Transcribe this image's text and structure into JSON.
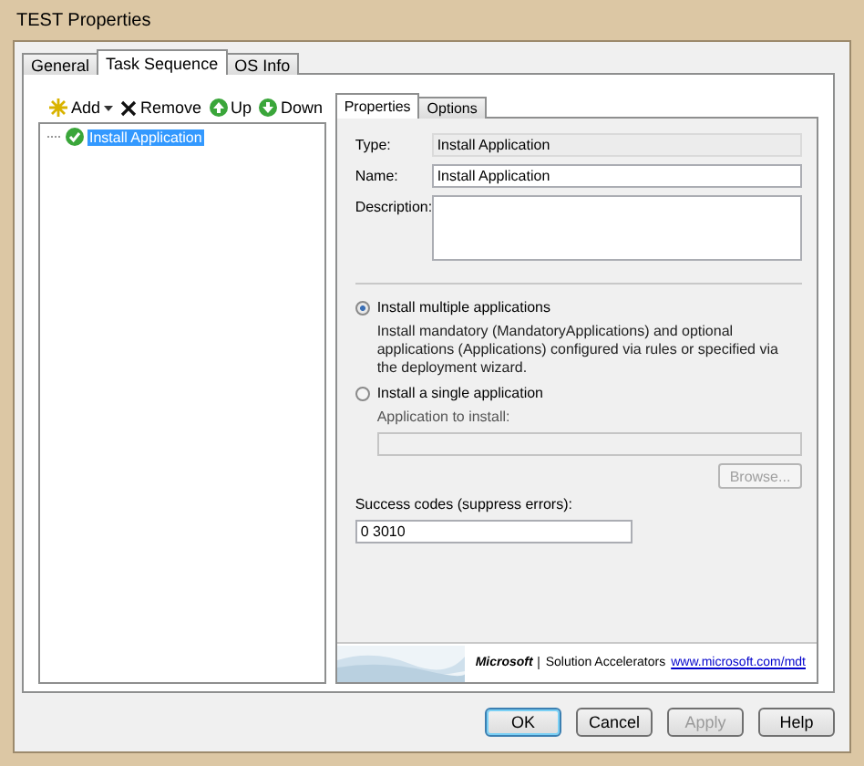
{
  "window": {
    "title": "TEST Properties"
  },
  "tabs": [
    {
      "label": "General",
      "selected": false
    },
    {
      "label": "Task Sequence",
      "selected": true
    },
    {
      "label": "OS Info",
      "selected": false
    }
  ],
  "toolbar": [
    {
      "kind": "add",
      "label": "Add",
      "dropdown": true
    },
    {
      "kind": "remove",
      "label": "Remove",
      "dropdown": false
    },
    {
      "kind": "up",
      "label": "Up",
      "dropdown": false
    },
    {
      "kind": "down",
      "label": "Down",
      "dropdown": false
    }
  ],
  "tree": [
    {
      "label": "Install Application",
      "selected": true
    }
  ],
  "inner_tabs": [
    {
      "label": "Properties",
      "selected": true
    },
    {
      "label": "Options",
      "selected": false
    }
  ],
  "fields": [
    {
      "kind": "readonly",
      "label": "Type:",
      "value": "Install Application"
    },
    {
      "kind": "text",
      "label": "Name:",
      "value": "Install Application"
    },
    {
      "kind": "multiline",
      "label": "Description:"
    }
  ],
  "radios": [
    {
      "label": "Install multiple applications",
      "selected": true,
      "description": "Install mandatory (MandatoryApplications) and optional applications (Applications) configured via rules or specified via the deployment wizard."
    },
    {
      "label": "Install a single application",
      "selected": false
    }
  ],
  "app_to_install": {
    "label": "Application to install:",
    "disabled": true
  },
  "browse_button": {
    "label": "Browse...",
    "disabled": true
  },
  "success_codes": {
    "label": "Success codes (suppress errors):",
    "value": "0 3010"
  },
  "footer": {
    "brand": "Microsoft",
    "product": "Solution Accelerators",
    "link": "www.microsoft.com/mdt"
  },
  "buttons": [
    {
      "label": "OK",
      "default": true,
      "disabled": false
    },
    {
      "label": "Cancel",
      "default": false,
      "disabled": false
    },
    {
      "label": "Apply",
      "default": false,
      "disabled": true
    },
    {
      "label": "Help",
      "default": false,
      "disabled": false
    }
  ]
}
